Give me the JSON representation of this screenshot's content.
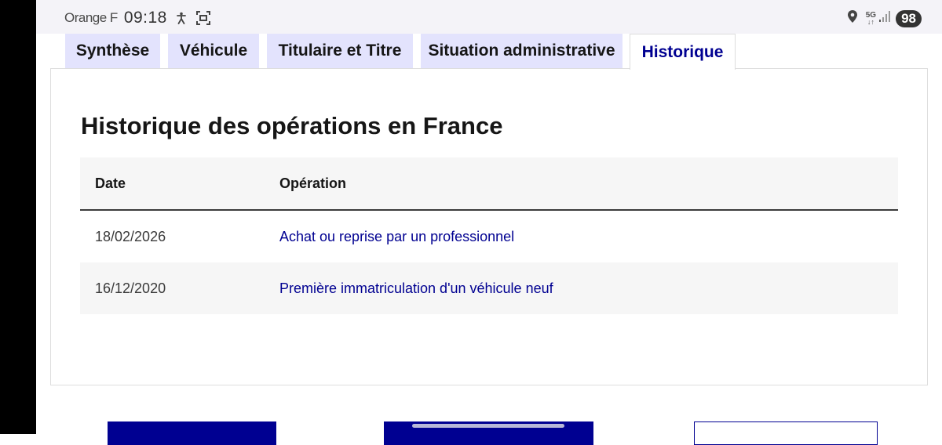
{
  "status_bar": {
    "carrier": "Orange F",
    "time": "09:18",
    "network": "5G",
    "battery": "98"
  },
  "tabs": [
    {
      "label": "Synthèse",
      "active": false
    },
    {
      "label": "Véhicule",
      "active": false
    },
    {
      "label": "Titulaire et Titre",
      "active": false
    },
    {
      "label": "Situation administrative",
      "active": false
    },
    {
      "label": "Historique",
      "active": true
    }
  ],
  "panel": {
    "title": "Historique des opérations en France",
    "columns": [
      "Date",
      "Opération"
    ],
    "rows": [
      {
        "date": "18/02/2026",
        "operation": "Achat ou reprise par un professionnel"
      },
      {
        "date": "16/12/2020",
        "operation": "Première immatriculation d'un véhicule neuf"
      }
    ]
  },
  "colors": {
    "accent": "#000091",
    "tab_bg": "#e3e3fd",
    "row_alt": "#f6f6f6",
    "text": "#161616"
  },
  "icons": [
    "accessibility-icon",
    "screenshot-icon",
    "location-pin-icon",
    "signal-bars-icon"
  ]
}
